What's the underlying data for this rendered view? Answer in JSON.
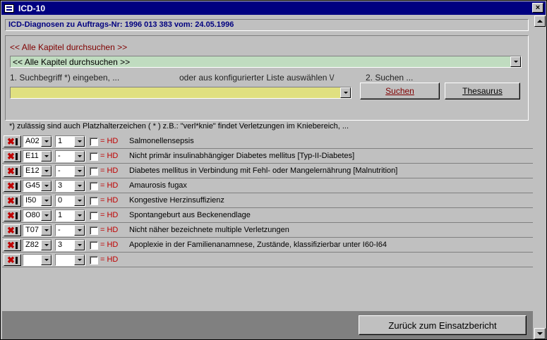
{
  "window": {
    "title": "ICD-10",
    "close_label": "×"
  },
  "header": {
    "text": "ICD-Diagnosen zu Auftrags-Nr: 1996 013 383 vom: 24.05.1996"
  },
  "search": {
    "chapter_label": "<< Alle Kapitel durchsuchen >>",
    "chapter_value": "<< Alle Kapitel durchsuchen >>",
    "step1_label": "1. Suchbegriff *) eingeben, ...",
    "or_label": "oder aus konfigurierter Liste auswählen \\/",
    "step2_label": "2. Suchen ...",
    "term_value": "",
    "search_button": "Suchen",
    "thesaurus_button": "Thesaurus",
    "hint": "*) zulässig sind auch Platzhalterzeichen ( * ) z.B.: \"verl*knie\" findet Verletzungen im Kniebereich, ..."
  },
  "rows": [
    {
      "code": "A02",
      "sub": "1",
      "hd": "= HD",
      "desc": "Salmonellensepsis"
    },
    {
      "code": "E11",
      "sub": "-",
      "hd": "= HD",
      "desc": "Nicht primär insulinabhängiger Diabetes mellitus [Typ-II-Diabetes]"
    },
    {
      "code": "E12",
      "sub": "-",
      "hd": "= HD",
      "desc": "Diabetes mellitus in Verbindung mit Fehl- oder Mangelernährung [Malnutrition]"
    },
    {
      "code": "G45",
      "sub": "3",
      "hd": "= HD",
      "desc": "Amaurosis fugax"
    },
    {
      "code": "I50",
      "sub": "0",
      "hd": "= HD",
      "desc": "Kongestive Herzinsuffizienz"
    },
    {
      "code": "O80",
      "sub": "1",
      "hd": "= HD",
      "desc": "Spontangeburt aus Beckenendlage"
    },
    {
      "code": "T07",
      "sub": "-",
      "hd": "= HD",
      "desc": "Nicht näher bezeichnete multiple Verletzungen"
    },
    {
      "code": "Z82",
      "sub": "3",
      "hd": "= HD",
      "desc": "Apoplexie in der Familienanamnese, Zustände, klassifizierbar unter I60-I64"
    },
    {
      "code": "",
      "sub": "",
      "hd": "= HD",
      "desc": ""
    }
  ],
  "footer": {
    "back_button": "Zurück zum Einsatzbericht"
  },
  "colors": {
    "title_bar": "#000080",
    "chapter_combo": "#c0dcc0",
    "term_input": "#e0e080",
    "hd_text": "#c00000"
  }
}
